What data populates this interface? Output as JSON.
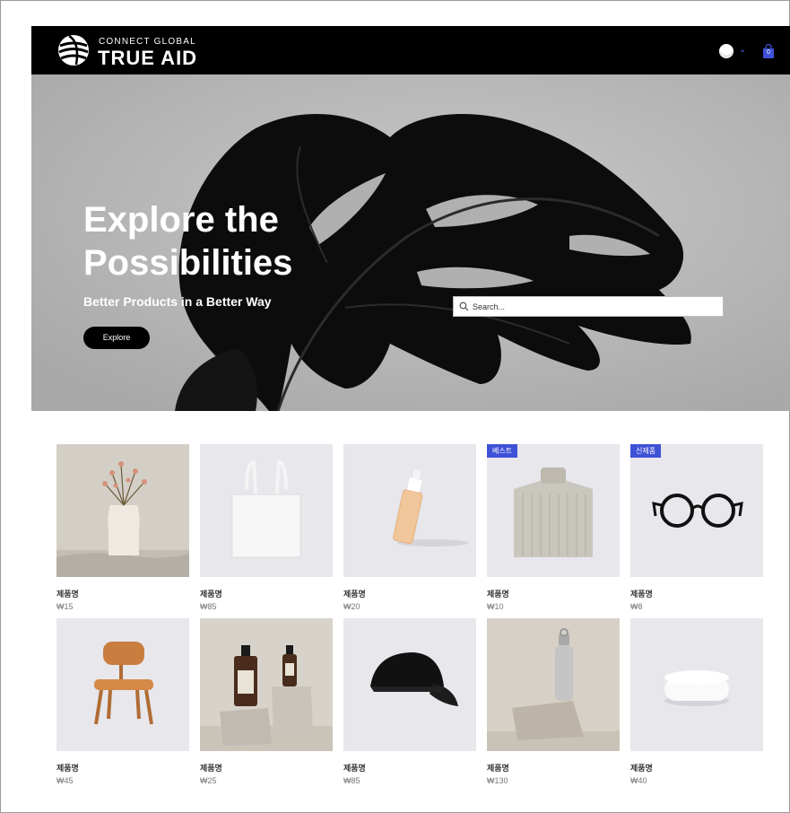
{
  "header": {
    "logo_small": "CONNECT GLOBAL",
    "logo_big": "TRUE AID",
    "cart_count": "0"
  },
  "hero": {
    "title": "Explore the Possibilities",
    "subtitle": "Better Products in a Better Way",
    "button": "Explore",
    "search_placeholder": "Search..."
  },
  "products": [
    {
      "name": "제품명",
      "price": "₩15",
      "badge": "",
      "image": "vase-with-dried-flowers"
    },
    {
      "name": "제품명",
      "price": "₩85",
      "badge": "",
      "image": "tote-bag"
    },
    {
      "name": "제품명",
      "price": "₩20",
      "badge": "",
      "image": "serum-bottle"
    },
    {
      "name": "제품명",
      "price": "₩10",
      "badge": "베스트",
      "image": "knit-sweater"
    },
    {
      "name": "제품명",
      "price": "₩8",
      "badge": "신제품",
      "image": "eyeglasses"
    },
    {
      "name": "제품명",
      "price": "₩45",
      "badge": "",
      "image": "wooden-chair"
    },
    {
      "name": "제품명",
      "price": "₩25",
      "badge": "",
      "image": "amber-bottles"
    },
    {
      "name": "제품명",
      "price": "₩85",
      "badge": "",
      "image": "baseball-cap"
    },
    {
      "name": "제품명",
      "price": "₩130",
      "badge": "",
      "image": "water-bottle"
    },
    {
      "name": "제품명",
      "price": "₩40",
      "badge": "",
      "image": "white-speaker"
    }
  ],
  "colors": {
    "header_bg": "#000000",
    "hero_bg": "#b3b3b3",
    "badge_bg": "#3f51d6",
    "cart": "#3f51d6"
  }
}
